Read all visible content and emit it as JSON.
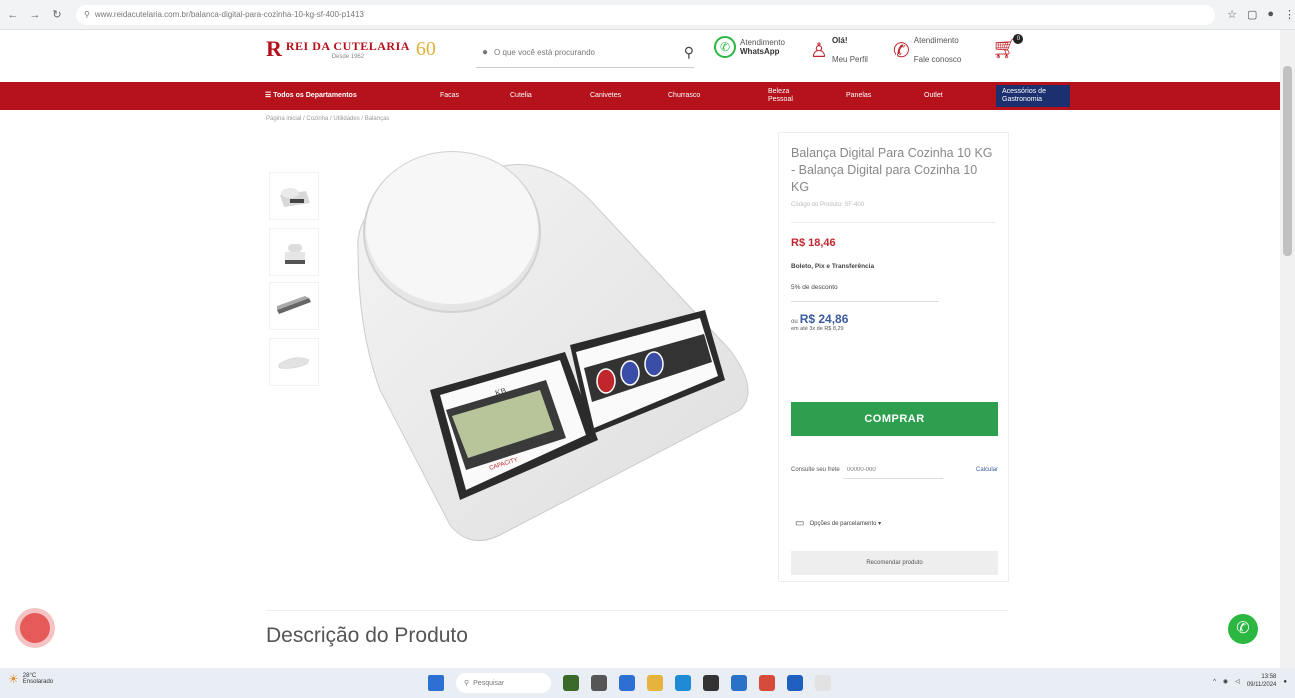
{
  "browser": {
    "url": "www.reidacutelaria.com.br/balanca-digital-para-cozinha-10-kg-sf-400-p1413",
    "icons": [
      "back-icon",
      "forward-icon",
      "reload-icon",
      "star-icon",
      "extensions-icon",
      "profile-icon",
      "menu-icon"
    ]
  },
  "header": {
    "logo_mark": "R",
    "logo_text": "REI DA CUTELARIA",
    "logo_sub": "Desde 1962",
    "logo_badge": "60",
    "search_placeholder": "O que você está procurando",
    "whatsapp_line1": "Atendimento",
    "whatsapp_line2": "WhatsApp",
    "account_line1": "Olá!",
    "account_line2": "Meu Perfil",
    "contact_line1": "Atendimento",
    "contact_line2": "Fale conosco",
    "cart_count": "0"
  },
  "nav": {
    "all": "☰ Todos os Departamentos",
    "items": [
      "Facas",
      "Cutelia",
      "Canivetes",
      "Churrasco",
      "Beleza Pessoal",
      "Panelas",
      "Outlet",
      "Acessórios de Gastronomia"
    ]
  },
  "breadcrumb": "Página inicial  /  Cozinha  /  Utilidades  /  Balanças",
  "product": {
    "title": "Balança Digital Para Cozinha 10 KG - Balança Digital para Cozinha 10 KG",
    "code": "Código do Produto: SF-400",
    "price_pix": "R$ 18,46",
    "pix_line": "Boleto, Pix e Transferência",
    "pix_discount": "5% de desconto",
    "price_card_prefix": "ou",
    "price_card": "R$ 24,86",
    "installments": "em até 3x de R$ 8,29",
    "buy_label": "COMPRAR",
    "cep_label": "Consulte seu frete",
    "cep_placeholder": "00000-000",
    "cep_button": "Calcular",
    "install_options": "Opções de parcelamento ▾",
    "recommend": "Recomendar produto"
  },
  "description_title": "Descrição do Produto",
  "taskbar": {
    "weather_temp": "28°C",
    "weather_desc": "Ensolarado",
    "search_placeholder": "Pesquisar",
    "time": "13:58",
    "date": "09/11/2024"
  }
}
